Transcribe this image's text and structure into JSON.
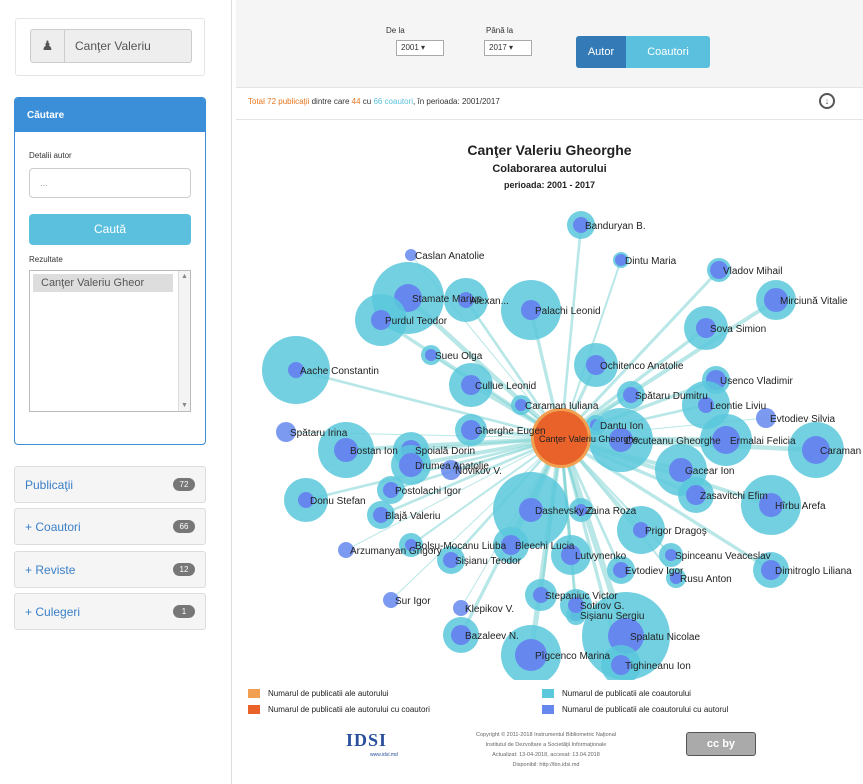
{
  "author_box": {
    "name": "Canţer Valeriu",
    "icon": "user-icon"
  },
  "search": {
    "title": "Căutare",
    "detail_label": "Detalii autor",
    "detail_placeholder": "...",
    "button": "Caută",
    "results_label": "Rezultate",
    "results": [
      "Canţer Valeriu Gheor"
    ]
  },
  "accordion": [
    {
      "label": "Publicaţii",
      "count": "72",
      "prefix": ""
    },
    {
      "label": "Coautori",
      "count": "66",
      "prefix": "+"
    },
    {
      "label": "Reviste",
      "count": "12",
      "prefix": "+"
    },
    {
      "label": "Culegeri",
      "count": "1",
      "prefix": "+"
    }
  ],
  "toolbar": {
    "from_label": "De la",
    "from_value": "2001",
    "to_label": "Până la",
    "to_value": "2017",
    "btn_autor": "Autor",
    "btn_coautori": "Coautori"
  },
  "summary": {
    "part1": "Total 72 publicaţii",
    "part2": " dintre care ",
    "part3": "44",
    "part4": " cu ",
    "part5": "66 coautori",
    "part6": ", în perioada: 2001/2017"
  },
  "chart": {
    "title": "Canţer Valeriu Gheorghe",
    "subtitle": "Colaborarea autorului",
    "period": "perioada: 2001 - 2017",
    "center_label": "Canţer Valeriu Gheorghe",
    "colors": {
      "author_total": "#f0a050",
      "author_coauth": "#e8622a",
      "coauthor_total": "#5bc8dc",
      "coauthor_with": "#6688ee",
      "link": "#7fd3d3"
    }
  },
  "legend": [
    {
      "label": "Numarul de publicatii ale autorului",
      "color": "#f0a050"
    },
    {
      "label": "Numarul de publicatii ale autorului cu coautori",
      "color": "#e8622a"
    },
    {
      "label": "Numarul de publicatii ale coautorului",
      "color": "#5bc8dc"
    },
    {
      "label": "Numarul de publicatii ale coautorului cu autorul",
      "color": "#6688ee"
    }
  ],
  "footer": {
    "logo": "IDSI",
    "logo_sub": "www.idsi.md",
    "copyright": "Copyright © 2011-2018 Instrumentul Bibliometric Naţional",
    "line2": "Institutul de Dezvoltare a Societăţii Informaţionale",
    "line3": "Actualizat: 13-04-2018, accesat: 13.04.2018",
    "line4": "Disponibil: http://ibn.idsi.md",
    "cc": "cc by"
  },
  "nodes": [
    {
      "label": "Banduryan B."
    },
    {
      "label": "Dintu Maria"
    },
    {
      "label": "Caslan Anatolie"
    },
    {
      "label": "Stamate Marius"
    },
    {
      "label": "Vladov Mihail"
    },
    {
      "label": "Palachi Leonid"
    },
    {
      "label": "Alexan..."
    },
    {
      "label": "Mirciună Vitalie"
    },
    {
      "label": "Purdul Teodor"
    },
    {
      "label": "Sova Simion"
    },
    {
      "label": "Sueu Olga"
    },
    {
      "label": "Cullue Leonid"
    },
    {
      "label": "Usenco Vladimir"
    },
    {
      "label": "Ochitenco Anatolie"
    },
    {
      "label": "Spătaru Dumitru"
    },
    {
      "label": "Aache Constantin"
    },
    {
      "label": "Caraman Iuliana"
    },
    {
      "label": "Leontie Liviu"
    },
    {
      "label": "Evtodiev Silvia"
    },
    {
      "label": "Gherghe Eugen"
    },
    {
      "label": "Dantu Ion"
    },
    {
      "label": "Spoială Dorin"
    },
    {
      "label": "Cocuteanu Gheorghe"
    },
    {
      "label": "Ermalai Felicia"
    },
    {
      "label": "Bostan Ion"
    },
    {
      "label": "Spătaru Irina"
    },
    {
      "label": "Drumea Anatolie"
    },
    {
      "label": "Gacear Ion"
    },
    {
      "label": "Caraman Mihail"
    },
    {
      "label": "Postolachi Igor"
    },
    {
      "label": "Novikov V."
    },
    {
      "label": "Zasavitchi Efim"
    },
    {
      "label": "Blajă Valeriu"
    },
    {
      "label": "Dashevsky Z."
    },
    {
      "label": "Zaina Roza"
    },
    {
      "label": "Donu Stefan"
    },
    {
      "label": "Bolşu-Mocanu Liuba"
    },
    {
      "label": "Prigor Dragoş"
    },
    {
      "label": "Hîrbu Arefa"
    },
    {
      "label": "Spinceanu Veaceslav"
    },
    {
      "label": "Arzumanyan Grigory"
    },
    {
      "label": "Sişianu Teodor"
    },
    {
      "label": "Bleechi Lucia"
    },
    {
      "label": "Lutvynenko"
    },
    {
      "label": "Evtodiev Igor"
    },
    {
      "label": "Rusu Anton"
    },
    {
      "label": "Stepaniuc Victor"
    },
    {
      "label": "Klepikov V."
    },
    {
      "label": "Sişianu Sergiu"
    },
    {
      "label": "Dimitroglo Liliana"
    },
    {
      "label": "Sur Igor"
    },
    {
      "label": "Sotirov G."
    },
    {
      "label": "Bazaleev N."
    },
    {
      "label": "Spalatu Nicolae"
    },
    {
      "label": "Pîgcenco Marina"
    },
    {
      "label": "Tighineanu Ion"
    }
  ]
}
